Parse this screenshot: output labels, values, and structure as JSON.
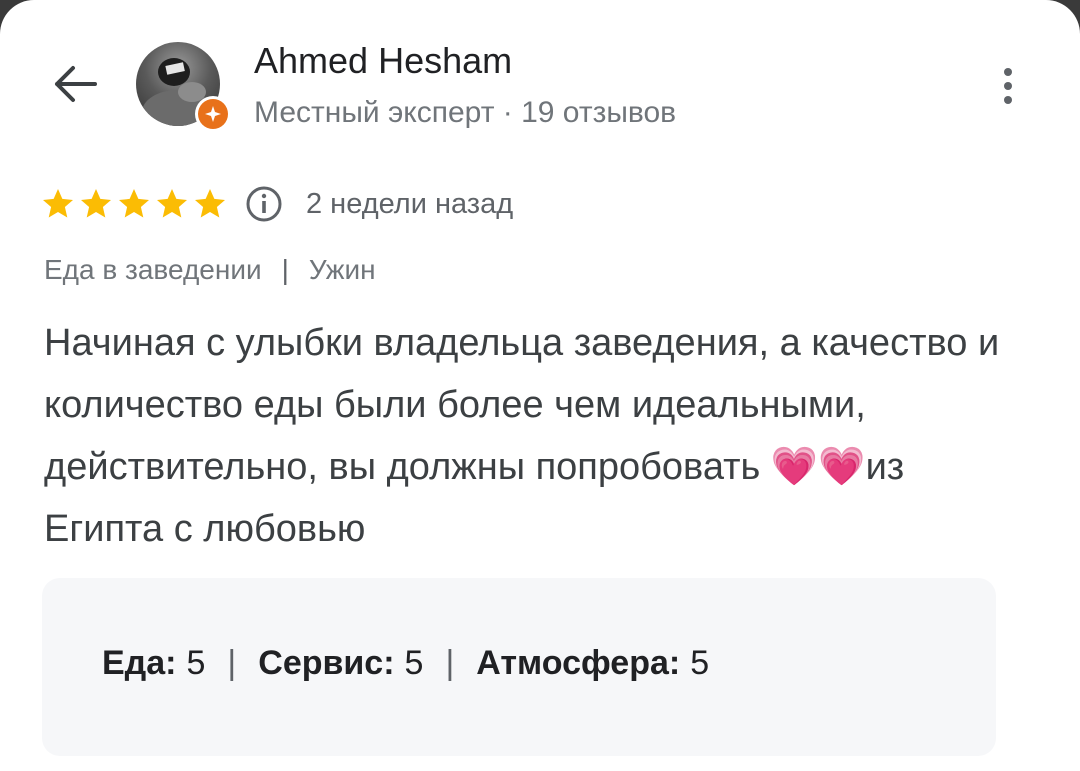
{
  "header": {
    "back_icon": "arrow-left-icon",
    "user_name": "Ahmed Hesham",
    "user_meta": "Местный эксперт · 19 отзывов",
    "badge_icon": "local-guide-star-icon",
    "more_icon": "more-vert-icon"
  },
  "review": {
    "stars": 5,
    "star_color": "#fbbc04",
    "info_icon": "info-icon",
    "date": "2 недели назад",
    "tags": [
      "Еда в заведении",
      "Ужин"
    ],
    "text": "Начиная с улыбки владельца заведения, а качество и количество еды были более чем идеальными, действительно, вы должны попробовать 💗💗из Египта с любовью"
  },
  "ratings": [
    {
      "label": "Еда:",
      "value": "5"
    },
    {
      "label": "Сервис:",
      "value": "5"
    },
    {
      "label": "Атмосфера:",
      "value": "5"
    }
  ],
  "colors": {
    "badge": "#e8711a",
    "heart": "#f4457a"
  }
}
